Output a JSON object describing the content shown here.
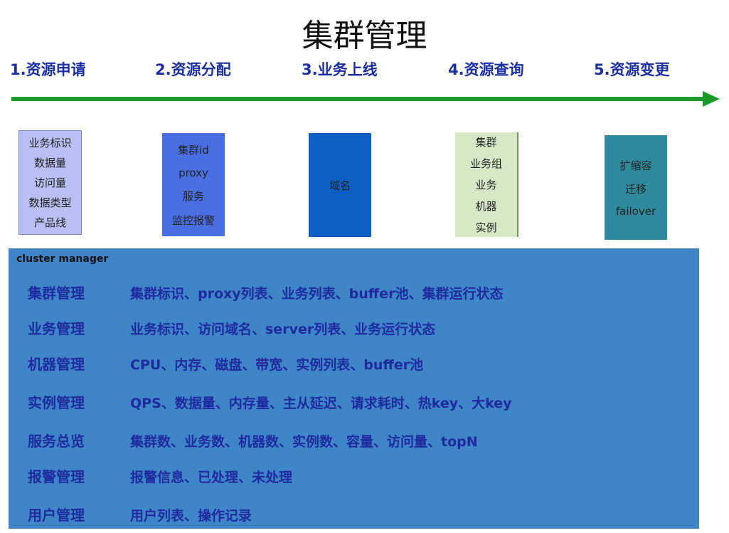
{
  "title": "集群管理",
  "steps": [
    "1.资源申请",
    "2.资源分配",
    "3.业务上线",
    "4.资源查询",
    "5.资源变更"
  ],
  "colors": {
    "arrow": "#1a9a2a",
    "box1": "#b9bff3",
    "box2": "#4a6fe3",
    "box3": "#0e5fc3",
    "box4": "#d6e8c6",
    "box5": "#2e8a9c",
    "panel": "#3f86c9",
    "text_dark_blue": "#1e2a9e"
  },
  "boxes": [
    {
      "items": [
        "业务标识",
        "数据量",
        "访问量",
        "数据类型",
        "产品线"
      ]
    },
    {
      "items": [
        "集群id",
        "proxy",
        "服务",
        "监控报警"
      ]
    },
    {
      "items": [
        "域名"
      ]
    },
    {
      "items": [
        "集群",
        "业务组",
        "业务",
        "机器",
        "实例"
      ]
    },
    {
      "items": [
        "扩缩容",
        "迁移",
        "failover"
      ]
    }
  ],
  "panel": {
    "title": "cluster manager",
    "rows": [
      {
        "name": "集群管理",
        "desc": "集群标识、proxy列表、业务列表、buffer池、集群运行状态"
      },
      {
        "name": "业务管理",
        "desc": "业务标识、访问域名、server列表、业务运行状态"
      },
      {
        "name": "机器管理",
        "desc": "CPU、内存、磁盘、带宽、实例列表、buffer池"
      },
      {
        "name": "实例管理",
        "desc": "QPS、数据量、内存量、主从延迟、请求耗时、热key、大key"
      },
      {
        "name": "服务总览",
        "desc": "集群数、业务数、机器数、实例数、容量、访问量、topN"
      },
      {
        "name": "报警管理",
        "desc": "报警信息、已处理、未处理"
      },
      {
        "name": "用户管理",
        "desc": "用户列表、操作记录"
      }
    ]
  }
}
